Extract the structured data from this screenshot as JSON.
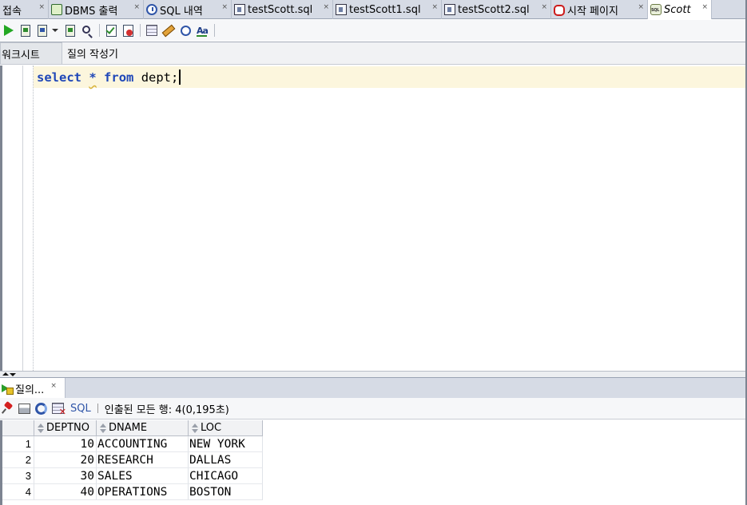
{
  "editor_tabs": [
    {
      "label": "접속",
      "icon": "none",
      "active": false
    },
    {
      "label": "DBMS 출력",
      "icon": "dbms-output-icon",
      "active": false
    },
    {
      "label": "SQL 내역",
      "icon": "sql-history-icon",
      "active": false
    },
    {
      "label": "testScott.sql",
      "icon": "sql-file-icon",
      "active": false
    },
    {
      "label": "testScott1.sql",
      "icon": "sql-file-icon",
      "active": false
    },
    {
      "label": "testScott2.sql",
      "icon": "sql-file-icon",
      "active": false
    },
    {
      "label": "시작 페이지",
      "icon": "oracle-icon",
      "active": false
    },
    {
      "label": "Scott",
      "icon": "sql-worksheet-icon",
      "active": true
    }
  ],
  "close_glyph": "×",
  "worksheet_tabs": {
    "worksheet": "워크시트",
    "query_builder": "질의 작성기"
  },
  "editor": {
    "code_tokens": [
      {
        "text": "select",
        "kind": "keyword"
      },
      {
        "text": " ",
        "kind": "plain"
      },
      {
        "text": "*",
        "kind": "star"
      },
      {
        "text": " ",
        "kind": "plain"
      },
      {
        "text": "from",
        "kind": "keyword"
      },
      {
        "text": " dept;",
        "kind": "plain"
      }
    ],
    "current_line_color": "#fcf6dd",
    "keyword_color": "#1f47b8"
  },
  "results": {
    "tab_label": "질의...",
    "sql_label": "SQL",
    "status": "인출된 모든 행: 4(0,195초)",
    "columns": [
      "DEPTNO",
      "DNAME",
      "LOC"
    ],
    "rows": [
      {
        "num": "1",
        "deptno": "10",
        "dname": "ACCOUNTING",
        "loc": "NEW YORK"
      },
      {
        "num": "2",
        "deptno": "20",
        "dname": "RESEARCH",
        "loc": "DALLAS"
      },
      {
        "num": "3",
        "deptno": "30",
        "dname": "SALES",
        "loc": "CHICAGO"
      },
      {
        "num": "4",
        "deptno": "40",
        "dname": "OPERATIONS",
        "loc": "BOSTON"
      }
    ]
  }
}
